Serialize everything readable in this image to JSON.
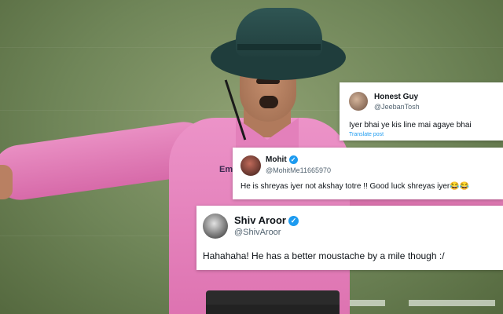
{
  "tweets": [
    {
      "name": "Honest Guy",
      "handle": "@JeebanTosh",
      "verified": false,
      "text": "Iyer bhai ye kis line mai agaye bhai",
      "translate": "Translate post"
    },
    {
      "name": "Mohit",
      "handle": "@MohitMe11665970",
      "verified": true,
      "text": "He is shreyas iyer not akshay totre !! Good luck shreyas iyer😂😂"
    },
    {
      "name": "Shiv Aroor",
      "handle": "@ShivAroor",
      "verified": true,
      "text": "Hahahaha! He has a better moustache by a mile though :/"
    }
  ],
  "background": {
    "shirt_logo": "Emi"
  },
  "colors": {
    "verified_badge": "#1d9bf0",
    "umpire_shirt": "#e584bd",
    "field": "#7a8f61",
    "hat": "#23403f"
  },
  "icons": {
    "verified": "verified-badge-icon"
  }
}
